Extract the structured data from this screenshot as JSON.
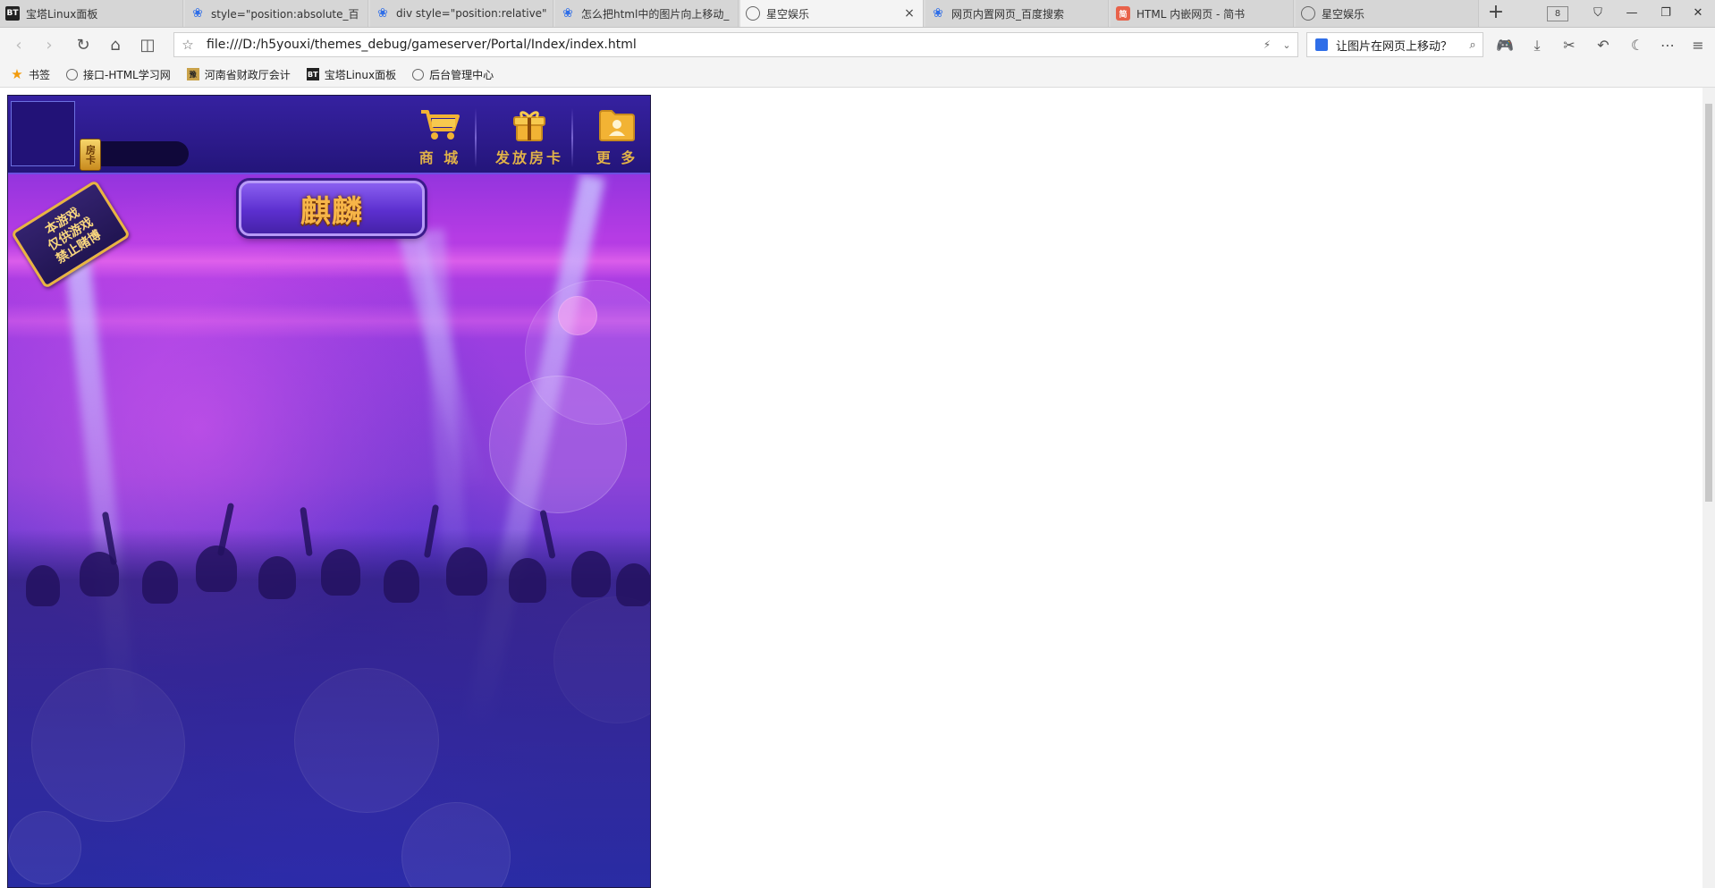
{
  "browser": {
    "tabs": [
      {
        "title": "宝塔Linux面板",
        "icon": "bt-favicon",
        "active": false
      },
      {
        "title": "style=\"position:absolute_百",
        "icon": "baidu-paw-favicon",
        "active": false
      },
      {
        "title": "div style=\"position:relative\"",
        "icon": "baidu-paw-favicon",
        "active": false
      },
      {
        "title": "怎么把html中的图片向上移动_",
        "icon": "baidu-paw-favicon",
        "active": false
      },
      {
        "title": "星空娱乐",
        "icon": "globe-favicon",
        "active": true
      },
      {
        "title": "网页内置网页_百度搜索",
        "icon": "baidu-paw-favicon",
        "active": false
      },
      {
        "title": "HTML 内嵌网页 - 简书",
        "icon": "jianshu-favicon",
        "active": false
      },
      {
        "title": "星空娱乐",
        "icon": "globe-favicon",
        "active": false
      }
    ],
    "tab_close_glyph": "×",
    "new_tab_glyph": "+",
    "tab_count": "8",
    "url": "file:///D:/h5youxi/themes_debug/gameserver/Portal/Index/index.html",
    "search_query": "让图片在网页上移动？",
    "bookmarks": [
      {
        "label": "书签",
        "icon": "star-icon"
      },
      {
        "label": "接口-HTML学习网",
        "icon": "globe-icon"
      },
      {
        "label": "河南省财政厅会计",
        "icon": "henan-icon"
      },
      {
        "label": "宝塔Linux面板",
        "icon": "bt-icon"
      },
      {
        "label": "后台管理中心",
        "icon": "globe-icon"
      }
    ]
  },
  "game": {
    "room_card_label": "房卡",
    "buttons": {
      "shop": "商 城",
      "issue_card": "发放房卡",
      "more": "更 多"
    },
    "game_title": "麒麟",
    "notice_lines": [
      "本游戏",
      "仅供游戏",
      "禁止赌博"
    ],
    "colors": {
      "gold": "#e0b24a",
      "topbar": "#2c1a8a",
      "background_purple": "#9a3fe0"
    }
  }
}
